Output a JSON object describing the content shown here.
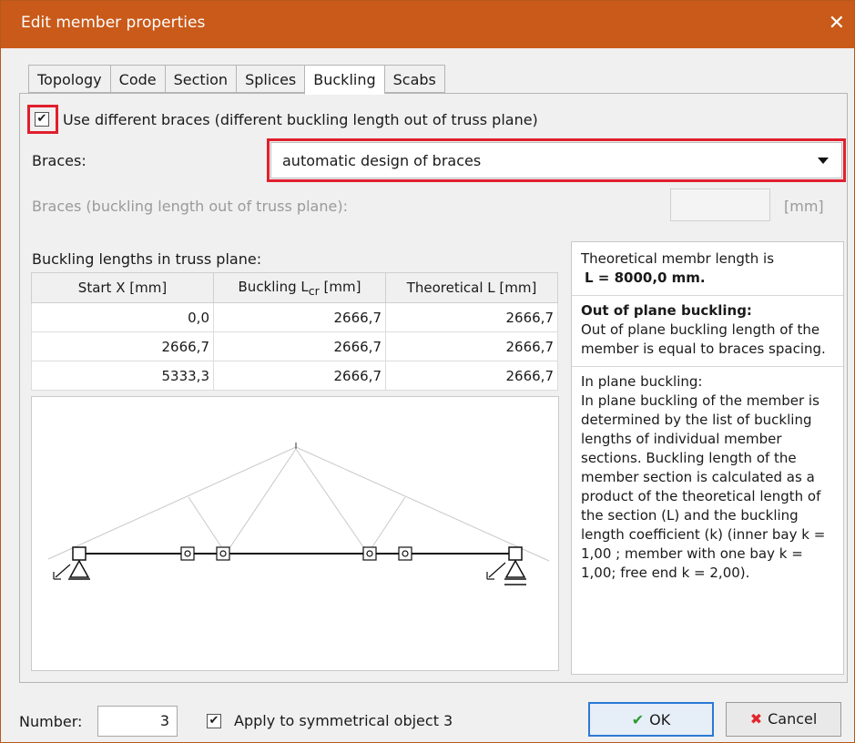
{
  "window": {
    "title": "Edit member properties"
  },
  "tabs": [
    "Topology",
    "Code",
    "Section",
    "Splices",
    "Buckling",
    "Scabs"
  ],
  "active_tab": "Buckling",
  "use_different_braces": {
    "checked": true,
    "label": "Use different braces (different buckling length out of truss plane)"
  },
  "braces": {
    "label": "Braces:",
    "value": "automatic design of braces"
  },
  "braces_length": {
    "label": "Braces (buckling length out of truss plane):",
    "unit": "[mm]",
    "value": ""
  },
  "table": {
    "title": "Buckling lengths in truss plane:",
    "headers": {
      "start": "Start X [mm]",
      "buckling_main": "Buckling L",
      "buckling_sub": "cr",
      "buckling_unit": " [mm]",
      "theoretical": "Theoretical L [mm]"
    },
    "rows": [
      [
        "0,0",
        "2666,7",
        "2666,7"
      ],
      [
        "2666,7",
        "2666,7",
        "2666,7"
      ],
      [
        "5333,3",
        "2666,7",
        "2666,7"
      ]
    ]
  },
  "info": {
    "line1": "Theoretical membr length is",
    "line2": "L = 8000,0 mm.",
    "heading": "Out of plane buckling:",
    "para1": "Out of plane buckling length of the member is equal to braces spacing.",
    "para2a": "In plane buckling:",
    "para2b": "In plane buckling of the member is determined by the list of buckling lengths of individual member sections. Buckling length of the member section is calculated as a product of the theoretical length of the section (L) and the buckling length coefficient (k) (inner bay k = 1,00 ; member with one bay k = 1,00; free end  k = 2,00)."
  },
  "footer": {
    "number_label": "Number:",
    "number_value": "3",
    "apply_checked": true,
    "apply_label": "Apply to symmetrical object 3",
    "ok": "OK",
    "cancel": "Cancel"
  }
}
